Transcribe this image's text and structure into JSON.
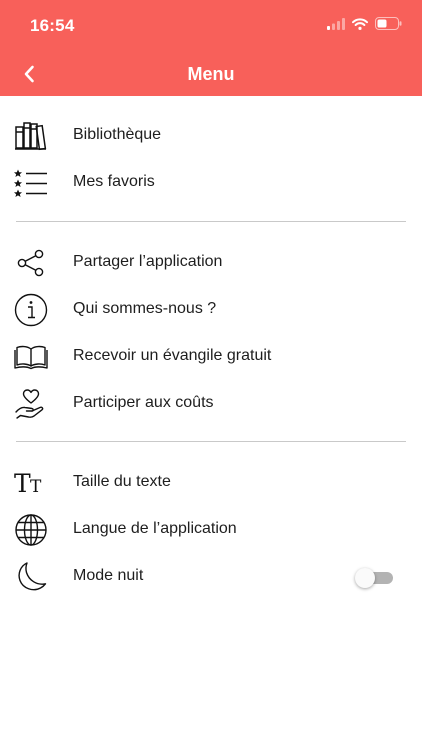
{
  "status_bar": {
    "time": "16:54"
  },
  "header": {
    "title": "Menu"
  },
  "menu": {
    "section1": [
      {
        "label": "Bibliothèque",
        "icon": "books-icon"
      },
      {
        "label": "Mes favoris",
        "icon": "starred-list-icon"
      }
    ],
    "section2": [
      {
        "label": "Partager l’application",
        "icon": "share-icon"
      },
      {
        "label": "Qui sommes-nous ?",
        "icon": "info-icon"
      },
      {
        "label": "Recevoir un évangile gratuit",
        "icon": "open-book-icon"
      },
      {
        "label": "Participer aux coûts",
        "icon": "heart-hand-icon"
      }
    ],
    "section3": [
      {
        "label": "Taille du texte",
        "icon": "text-size-icon"
      },
      {
        "label": "Langue de l’application",
        "icon": "globe-icon"
      },
      {
        "label": "Mode nuit",
        "icon": "moon-icon",
        "toggle_on": false
      }
    ]
  },
  "colors": {
    "header": "#f8605a",
    "divider": "#c9c9c9",
    "text": "#1e1e1e"
  }
}
